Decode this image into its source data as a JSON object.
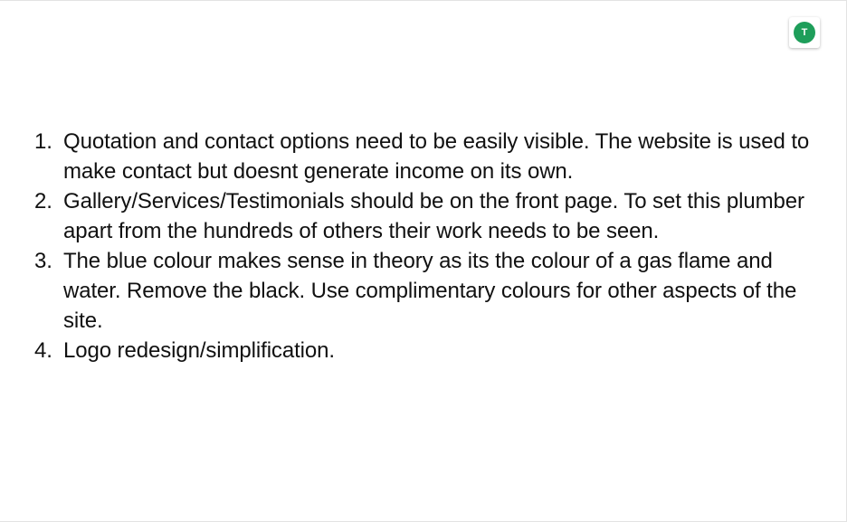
{
  "avatar": {
    "initial": "T",
    "color": "#1e9e5a"
  },
  "notes": {
    "items": [
      {
        "number": "1.",
        "text": "Quotation and contact options need to be easily visible. The website is used to make contact but doesnt generate income on its own."
      },
      {
        "number": "2.",
        "text": "Gallery/Services/Testimonials should be on the front page. To set this plumber apart from the hundreds of others their work needs to be seen."
      },
      {
        "number": "3.",
        "text": "The blue colour makes sense in theory as its the colour of a gas flame and water. Remove the black. Use complimentary colours for other aspects of the site."
      },
      {
        "number": "4.",
        "text": "Logo redesign/simplification."
      }
    ]
  }
}
